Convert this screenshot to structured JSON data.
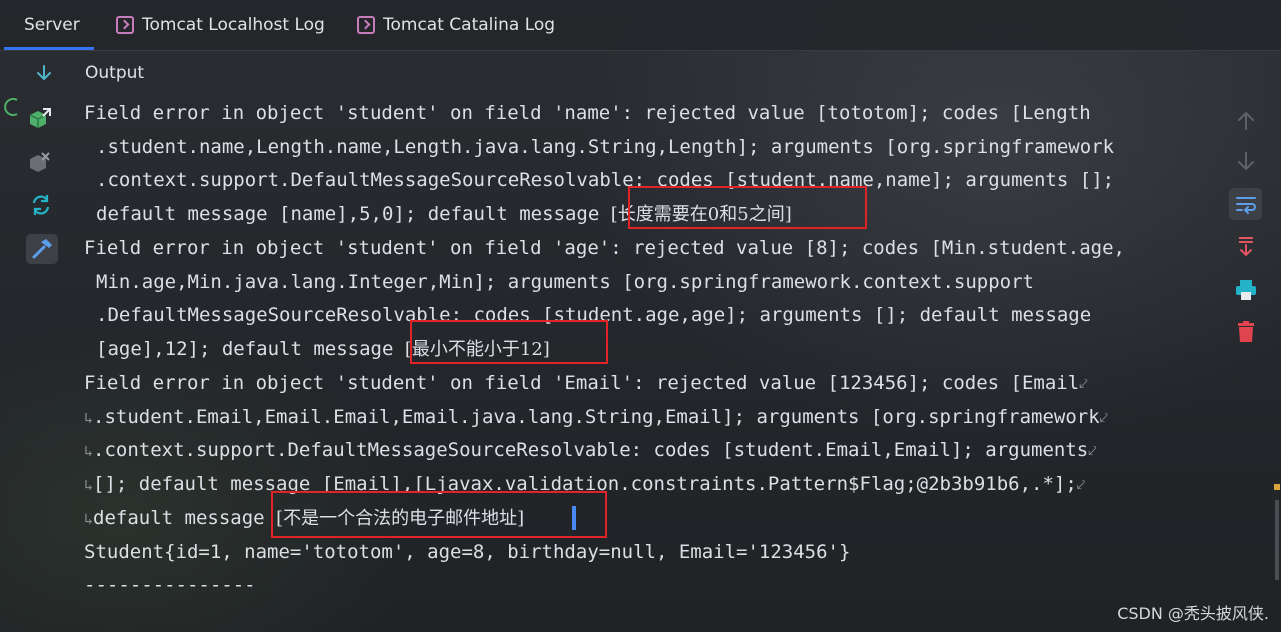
{
  "tabs": [
    {
      "label": "Server",
      "icon": "none",
      "active": true
    },
    {
      "label": "Tomcat Localhost Log",
      "icon": "terminal-icon",
      "active": false
    },
    {
      "label": "Tomcat Catalina Log",
      "icon": "terminal-icon",
      "active": false
    }
  ],
  "output": {
    "label": "Output"
  },
  "console": {
    "lines": [
      "Field error in object 'student' on field 'name': rejected value [tototom]; codes [Length",
      ".student.name,Length.name,Length.java.lang.String,Length]; arguments [org.springframework",
      ".context.support.DefaultMessageSourceResolvable: codes [student.name,name]; arguments [];",
      "default message [name],5,0]; default message ",
      "[长度需要在0和5之间]",
      "Field error in object 'student' on field 'age': rejected value [8]; codes [Min.student.age,",
      "Min.age,Min.java.lang.Integer,Min]; arguments [org.springframework.context.support",
      ".DefaultMessageSourceResolvable: codes [student.age,age]; arguments []; default message",
      "[age],12]; default message ",
      "[最小不能小于12]",
      "Field error in object 'student' on field 'Email': rejected value [123456]; codes [Email",
      ".student.Email,Email.Email,Email.java.lang.String,Email]; arguments [org.springframework",
      ".context.support.DefaultMessageSourceResolvable: codes [student.Email,Email]; arguments",
      "[]; default message [Email],[Ljavax.validation.constraints.Pattern$Flag;@2b3b91b6,.*];",
      "default message ",
      "[不是一个合法的电子邮件地址]",
      "Student{id=1, name='tototom', age=8, birthday=null, Email='123456'}",
      "---------------"
    ],
    "wrap_marker": "⤦",
    "wrap_continue_marker": "↳"
  },
  "watermark": "CSDN @秃头披风侠.",
  "colors": {
    "accent": "#3574f0",
    "highlight_box": "#e02428",
    "text": "#dcdfe4",
    "tab_icon": "#c77dbb",
    "deploy_green": "#4fb06a",
    "update_cyan": "#23b4c8",
    "scroll_to_end_red": "#e05561",
    "print_cyan": "#22b3c9",
    "delete_red": "#e0454f"
  }
}
